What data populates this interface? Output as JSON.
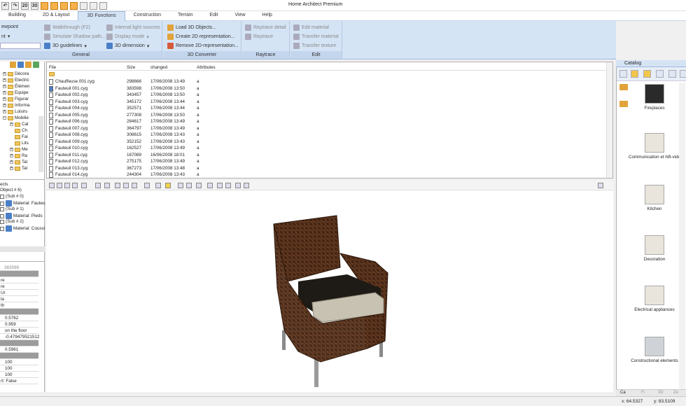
{
  "app": {
    "title": "Home Architect Premium"
  },
  "menu_tabs": [
    "Building",
    "2D & Layout",
    "3D Functions",
    "Construction",
    "Terrain",
    "Edit",
    "View",
    "Help"
  ],
  "quick_access": [
    "20",
    "30"
  ],
  "ribbon": {
    "general": {
      "label": "General",
      "viewpoint": "ewpoint",
      "walkthrough": "Walkthrough (F2)",
      "simulate_shadow": "Simulate Shadow path...",
      "guidelines": "3D guidelines",
      "internal_light": "Internal light sources",
      "display_mode": "Display mode",
      "dimension": "3D dimension",
      "left_cut_item": "nt"
    },
    "converter": {
      "label": "3D Converter",
      "load": "Load 3D Objects...",
      "create": "Create 2D representation...",
      "remove": "Remove 2D-representation..."
    },
    "raytrace": {
      "label": "Raytrace",
      "detail": "Raytrace detail",
      "raytrace": "Raytrace"
    },
    "edit": {
      "label": "Edit",
      "edit_material": "Edit material",
      "transfer_material": "Transfer material",
      "transfer_texture": "Transfer texture"
    }
  },
  "tree": {
    "items": [
      "Décora",
      "Electric",
      "Élémen",
      "Equipe",
      "Figurar",
      "Informa",
      "Loisirs",
      "Mobilie",
      "Cal",
      "Ch",
      "Fai",
      "Lits",
      "Me",
      "Ra",
      "Tal",
      "Tal"
    ]
  },
  "objects": {
    "header": "ects",
    "object": "Object # 6)",
    "sub0": "(Sub # 0)",
    "mat0": "Material: Fauteu",
    "sub1": "(Sub # 1)",
    "mat1": "Material: Pieds",
    "sub2": "(Sub # 2)",
    "mat2": "Material: Coussi"
  },
  "properties": {
    "size_value": "383598",
    "lines": [
      "re",
      "re",
      "Ur",
      "la",
      "th"
    ],
    "v1": "0.5762",
    "v2": "0.959",
    "on_floor": "on the floor",
    "v3": "-0.479479521512",
    "v4": "0.5961",
    "n1": "100",
    "n2": "100",
    "n3": "100",
    "last": "rt: False"
  },
  "filelist": {
    "columns": {
      "file": "File",
      "size": "Size",
      "changed": "changed",
      "attributes": "Attributes"
    },
    "rows": [
      {
        "name": "Chauffeuse 001.cyg",
        "size": "298666",
        "changed": "17/06/2008 13:49",
        "attr": "a"
      },
      {
        "name": "Fauteuil 001.cyg",
        "size": "383598",
        "changed": "17/06/2008 13:50",
        "attr": "a"
      },
      {
        "name": "Fauteuil 002.cyg",
        "size": "343457",
        "changed": "17/06/2008 13:50",
        "attr": "a"
      },
      {
        "name": "Fauteuil 003.cyg",
        "size": "345172",
        "changed": "17/06/2008 13:44",
        "attr": "a"
      },
      {
        "name": "Fauteuil 004.cyg",
        "size": "352571",
        "changed": "17/06/2008 13:44",
        "attr": "a"
      },
      {
        "name": "Fauteuil 005.cyg",
        "size": "277308",
        "changed": "17/06/2008 13:50",
        "attr": "a"
      },
      {
        "name": "Fauteuil 006.cyg",
        "size": "284617",
        "changed": "17/06/2008 13:49",
        "attr": "a"
      },
      {
        "name": "Fauteuil 007.cyg",
        "size": "364797",
        "changed": "17/06/2008 13:49",
        "attr": "a"
      },
      {
        "name": "Fauteuil 008.cyg",
        "size": "308615",
        "changed": "17/06/2008 13:43",
        "attr": "a"
      },
      {
        "name": "Fauteuil 009.cyg",
        "size": "352152",
        "changed": "17/06/2008 13:43",
        "attr": "a"
      },
      {
        "name": "Fauteuil 010.cyg",
        "size": "162527",
        "changed": "17/06/2008 13:49",
        "attr": "a"
      },
      {
        "name": "Fauteuil 011.cyg",
        "size": "167089",
        "changed": "16/06/2008 18:01",
        "attr": "a"
      },
      {
        "name": "Fauteuil 012.cyg",
        "size": "275175",
        "changed": "17/06/2008 13:49",
        "attr": "a"
      },
      {
        "name": "Fauteuil 013.cyg",
        "size": "367273",
        "changed": "17/06/2008 13:48",
        "attr": "a"
      },
      {
        "name": "Fauteuil 014.cyg",
        "size": "244304",
        "changed": "17/06/2008 13:43",
        "attr": "a"
      }
    ]
  },
  "catalog": {
    "title": "Catalog",
    "items": [
      "Fireplaces",
      "Communication et hifi-vidé",
      "Kitchen",
      "Decoration",
      "Electrical appliances",
      "Constructional elements"
    ],
    "bottom_tabs": [
      "Ca",
      "Fi",
      "3D",
      "Ze"
    ]
  },
  "status": {
    "x": "x: 64.5327",
    "y": "y: 83.5109"
  },
  "colors": {
    "ribbon": "#d5e4f5",
    "accent": "#4a7fc7",
    "folder": "#efc75e"
  }
}
